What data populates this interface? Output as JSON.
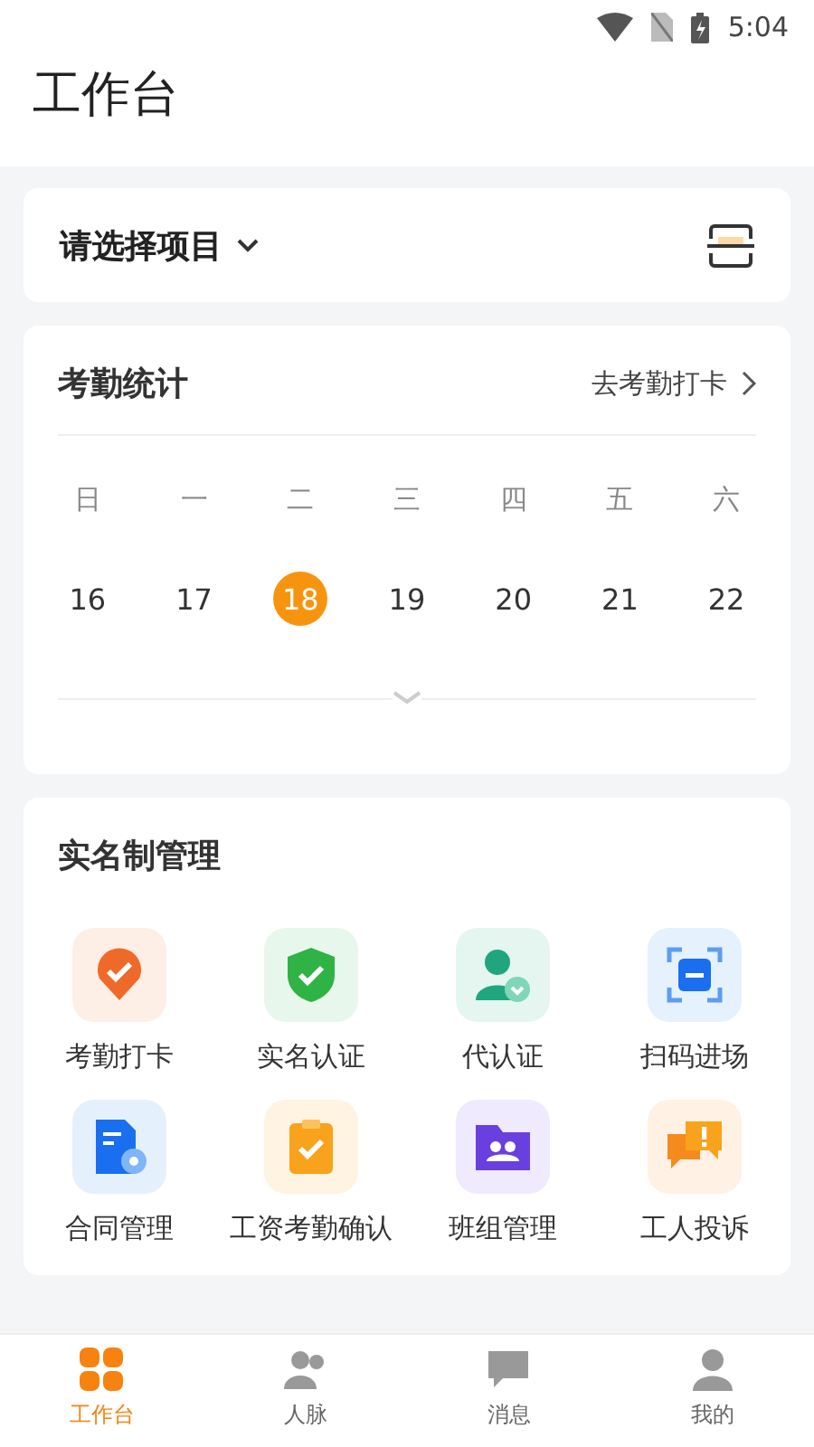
{
  "status_bar": {
    "time": "5:04"
  },
  "header": {
    "title": "工作台"
  },
  "project": {
    "label": "请选择项目"
  },
  "attendance": {
    "title": "考勤统计",
    "link": "去考勤打卡",
    "weekdays": [
      "日",
      "一",
      "二",
      "三",
      "四",
      "五",
      "六"
    ],
    "days": [
      {
        "label": "16",
        "selected": false
      },
      {
        "label": "17",
        "selected": false
      },
      {
        "label": "18",
        "selected": true
      },
      {
        "label": "19",
        "selected": false
      },
      {
        "label": "20",
        "selected": false
      },
      {
        "label": "21",
        "selected": false
      },
      {
        "label": "22",
        "selected": false
      }
    ]
  },
  "management": {
    "title": "实名制管理",
    "items": [
      {
        "label": "考勤打卡",
        "kind": "pin"
      },
      {
        "label": "实名认证",
        "kind": "shield"
      },
      {
        "label": "代认证",
        "kind": "person"
      },
      {
        "label": "扫码进场",
        "kind": "scan"
      },
      {
        "label": "合同管理",
        "kind": "document"
      },
      {
        "label": "工资考勤确认",
        "kind": "clipboard"
      },
      {
        "label": "班组管理",
        "kind": "folder"
      },
      {
        "label": "工人投诉",
        "kind": "chat"
      }
    ]
  },
  "tabs": [
    {
      "label": "工作台",
      "selected": true
    },
    {
      "label": "人脉",
      "selected": false
    },
    {
      "label": "消息",
      "selected": false
    },
    {
      "label": "我的",
      "selected": false
    }
  ]
}
